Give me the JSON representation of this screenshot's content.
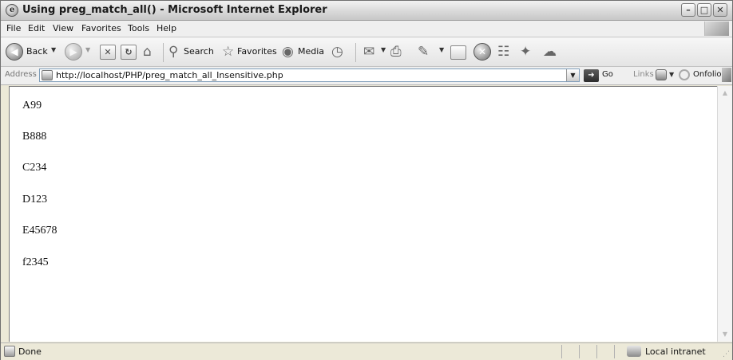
{
  "window": {
    "title": "Using preg_match_all() - Microsoft Internet Explorer",
    "title_icon": "ie-icon",
    "controls": {
      "minimize": "–",
      "maximize": "□",
      "close": "✕"
    }
  },
  "menubar": {
    "items": [
      "File",
      "Edit",
      "View",
      "Favorites",
      "Tools",
      "Help"
    ]
  },
  "toolbar": {
    "back_label": "Back",
    "search_label": "Search",
    "favorites_label": "Favorites",
    "media_label": "Media",
    "icons": [
      "back-icon",
      "forward-icon",
      "stop-icon",
      "refresh-icon",
      "home-icon",
      "search-icon",
      "favorites-star-icon",
      "media-icon",
      "history-icon",
      "mail-icon",
      "print-icon",
      "edit-icon",
      "discuss-icon",
      "messenger-icon",
      "research-icon",
      "tools-icon",
      "chat-icon"
    ]
  },
  "addressbar": {
    "label": "Address",
    "url": "http://localhost/PHP/preg_match_all_Insensitive.php",
    "go_label": "Go",
    "links_label": "Links",
    "onfolio_label": "Onfolio"
  },
  "content": {
    "lines": [
      "A99",
      "B888",
      "C234",
      "D123",
      "E45678",
      "f2345"
    ]
  },
  "statusbar": {
    "status": "Done",
    "zone": "Local intranet"
  }
}
